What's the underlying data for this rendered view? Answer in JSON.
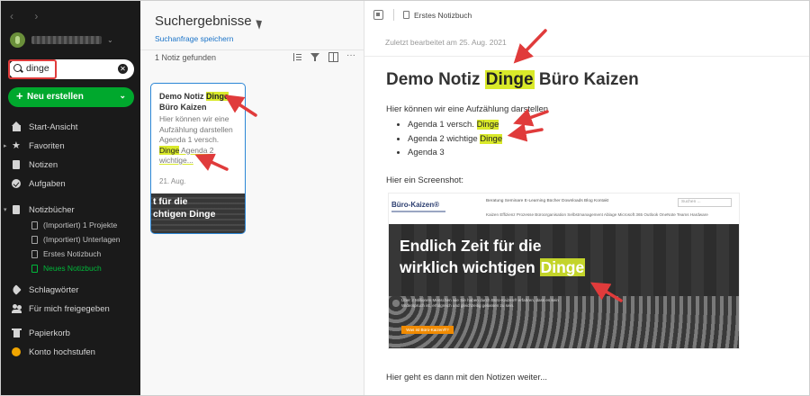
{
  "sidebar": {
    "nav": "‹   ›",
    "search_value": "dinge",
    "new_button": "Neu erstellen",
    "items": [
      {
        "label": "Start-Ansicht"
      },
      {
        "label": "Favoriten"
      },
      {
        "label": "Notizen"
      },
      {
        "label": "Aufgaben"
      },
      {
        "label": "Notizbücher"
      },
      {
        "label": "Schlagwörter"
      },
      {
        "label": "Für mich freigegeben"
      },
      {
        "label": "Papierkorb"
      },
      {
        "label": "Konto hochstufen"
      }
    ],
    "notebooks": [
      {
        "label": "(Importiert) 1 Projekte"
      },
      {
        "label": "(Importiert) Unterlagen"
      },
      {
        "label": "Erstes Notizbuch"
      },
      {
        "label": "Neues Notizbuch"
      }
    ]
  },
  "middle": {
    "title": "Suchergebnisse",
    "save_search": "Suchanfrage speichern",
    "count": "1 Notiz gefunden",
    "card": {
      "title_pre": "Demo Notiz ",
      "title_hl": "Dinge",
      "title_post": " Büro Kaizen",
      "snippet_pre": "Hier können wir eine Aufzählung darstellen Agenda 1 versch. ",
      "snippet_hl": "Dinge",
      "snippet_post": " Agenda 2 wichtige...",
      "date": "21. Aug.",
      "thumb_line1": "t für die",
      "thumb_line2": "chtigen Dinge"
    }
  },
  "editor": {
    "notebook": "Erstes Notizbuch",
    "last_edited": "Zuletzt bearbeitet am 25. Aug. 2021",
    "title_pre": "Demo Notiz ",
    "title_hl": "Dinge",
    "title_post": " Büro Kaizen",
    "intro": "Hier können wir eine Aufzählung darstellen",
    "bullets": [
      {
        "pre": "Agenda 1 versch. ",
        "hl": "Dinge"
      },
      {
        "pre": "Agenda 2 wichtige ",
        "hl": "Dinge"
      },
      {
        "pre": "Agenda 3",
        "hl": ""
      }
    ],
    "screenshot_label": "Hier ein Screenshot:",
    "footer": "Hier geht es dann mit den Notizen weiter...",
    "embedded": {
      "logo": "Büro-Kaizen®",
      "nav": "Beratung   Seminare   E-Learning   Bücher   Downloads   Blog   Kontakt",
      "search": "Suchen ...",
      "nav2": "Kaizen  Effizienz  Prozesse  Büroorganisation  Selbstmanagement  Ablage  Microsoft 365  Outlook  OneNote  Teams  Hardware",
      "hero_line1": "Endlich Zeit für die",
      "hero_line2_pre": "wirklich wichtigen ",
      "hero_line2_hl": "Dinge",
      "hero_small": "Über 2 Millionen Menschen wie Sie haben durch Büro-Kaizen® erfahren, dass es kein Widerspruch ist, erfolgreich und gleichzeitig gelassen zu sein.",
      "hero_button": "Was ist Büro-Kaizen®?"
    }
  },
  "colors": {
    "sidebar_bg": "#1a1a1a",
    "accent_green": "#00a82d",
    "highlight": "#d9e92a",
    "annotation_red": "#e03b3b",
    "card_border": "#2b86d6"
  }
}
